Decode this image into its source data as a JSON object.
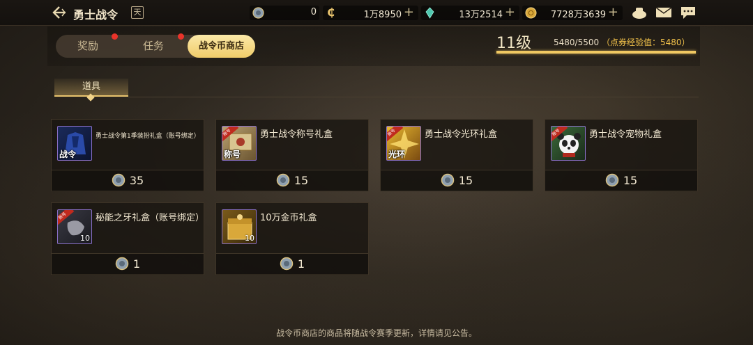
{
  "header": {
    "title": "勇士战令",
    "calendar_icon_label": "天",
    "currencies": [
      {
        "icon": "battlepass-coin-icon",
        "value": "0",
        "has_plus": false
      },
      {
        "icon": "c-coin-icon",
        "value": "1万8950",
        "has_plus": true
      },
      {
        "icon": "crystal-icon",
        "value": "13万2514",
        "has_plus": true
      },
      {
        "icon": "gold-icon",
        "value": "7728万3639",
        "has_plus": true
      }
    ]
  },
  "tabs": [
    {
      "label": "奖励",
      "has_dot": true
    },
    {
      "label": "任务",
      "has_dot": true
    },
    {
      "label": "战令币商店",
      "active": true
    }
  ],
  "level": {
    "text": "11级",
    "exp": "5480/5500",
    "note": "（点券经验值：5480）",
    "progress": 0.996
  },
  "category": "道具",
  "items": [
    {
      "name": "勇士战令第1季装扮礼盒（账号绑定）",
      "price": "35",
      "tag": "战令",
      "ribbon": "",
      "qty": ""
    },
    {
      "name": "勇士战令称号礼盒",
      "price": "15",
      "tag": "称号",
      "ribbon": "账号",
      "qty": ""
    },
    {
      "name": "勇士战令光环礼盒",
      "price": "15",
      "tag": "光环",
      "ribbon": "账号",
      "qty": ""
    },
    {
      "name": "勇士战令宠物礼盒",
      "price": "15",
      "tag": "",
      "ribbon": "账号",
      "qty": ""
    },
    {
      "name": "秘能之牙礼盒（账号绑定）",
      "price": "1",
      "tag": "",
      "ribbon": "账号",
      "qty": "10"
    },
    {
      "name": "10万金币礼盒",
      "price": "1",
      "tag": "",
      "ribbon": "",
      "qty": "10"
    }
  ],
  "footer": "战令币商店的商品将随战令赛季更新，详情请见公告。",
  "colors": {
    "accent": "#f0c862",
    "tab_active": "#f6dc8a",
    "dot": "#e8332a"
  }
}
